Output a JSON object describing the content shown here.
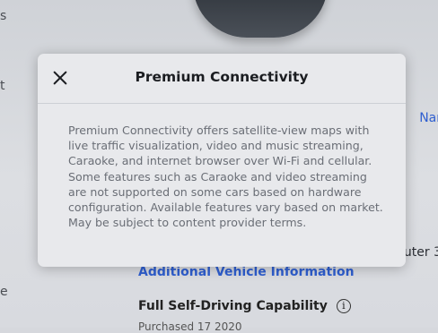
{
  "background": {
    "edge_letters": [
      "s",
      "t",
      "e"
    ],
    "name_link_fragment": "Nar",
    "computer_fragment": "uter 3",
    "additional_info_link": "Additional Vehicle Information",
    "fsd_label": "Full Self-Driving Capability",
    "fsd_info_icon": "i",
    "date_fragment": "Purchased 17 2020"
  },
  "modal": {
    "title": "Premium Connectivity",
    "close_icon": "close-icon",
    "body": "Premium Connectivity offers satellite-view maps with live traffic visualization, video and music streaming, Caraoke, and internet browser over Wi-Fi and cellular. Some features such as Caraoke and video streaming are not supported on some cars based on hardware configuration. Available features vary based on market. May be subject to content provider terms."
  }
}
